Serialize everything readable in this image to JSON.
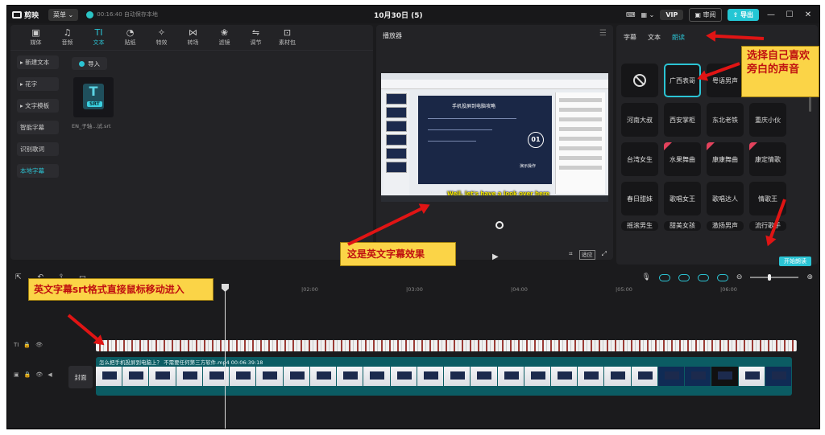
{
  "app": {
    "name": "剪映",
    "menu": "菜单",
    "save_status": "00:16:40 自动保存本地",
    "project_title": "10月30日 (5)",
    "vip": "VIP",
    "review": "审阅",
    "export": "导出"
  },
  "media_tools": [
    {
      "label": "媒体",
      "icon": "media-icon"
    },
    {
      "label": "音频",
      "icon": "audio-icon"
    },
    {
      "label": "文本",
      "icon": "text-icon"
    },
    {
      "label": "贴纸",
      "icon": "sticker-icon"
    },
    {
      "label": "特效",
      "icon": "effects-icon"
    },
    {
      "label": "转场",
      "icon": "transition-icon"
    },
    {
      "label": "滤镜",
      "icon": "filter-icon"
    },
    {
      "label": "调节",
      "icon": "adjust-icon"
    },
    {
      "label": "素材包",
      "icon": "package-icon"
    }
  ],
  "text_sidebar": [
    "▸ 新建文本",
    "▸ 花字",
    "▸ 文字模板",
    "智能字幕",
    "识别歌词",
    "本地字幕"
  ],
  "import_label": "导入",
  "srt_file": {
    "badge": "SRT",
    "name": "EN_子轴...试.srt"
  },
  "player": {
    "title": "播放器",
    "subtitle_text": "Well, let's have a look over here",
    "slide_title": "手机投屏到电脑攻略",
    "slide_number": "01",
    "slide_foot": "演示操作",
    "fit_btn": "适应"
  },
  "right_panel": {
    "tabs": [
      "字幕",
      "文本",
      "朗读"
    ],
    "voices": [
      "",
      "广西表哥",
      "粤语男声",
      "",
      "河南大叔",
      "西安掌柜",
      "东北老铁",
      "重庆小伙",
      "台湾女生",
      "水果舞曲",
      "康康舞曲",
      "康定情歌",
      "春日甜妹",
      "歌唱女王",
      "歌唱达人",
      "情歌王",
      "摇滚男生",
      "甜美女孩",
      "激扬男声",
      "流行歌手"
    ],
    "start_label": "开始朗读"
  },
  "timeline": {
    "ruler": [
      "|02:00",
      "|03:00",
      "|04:00",
      "|05:00",
      "|06:00"
    ],
    "video_label": "怎么把手机投屏到电脑上？ 不需要任何第三方软件.mp4    00:06:39:18",
    "cover": "封面"
  },
  "annotations": {
    "top_right": "选择自己喜欢旁白的声音",
    "player": "这是英文字幕效果",
    "timeline": "英文字幕srt格式直接鼠标移动进入"
  }
}
